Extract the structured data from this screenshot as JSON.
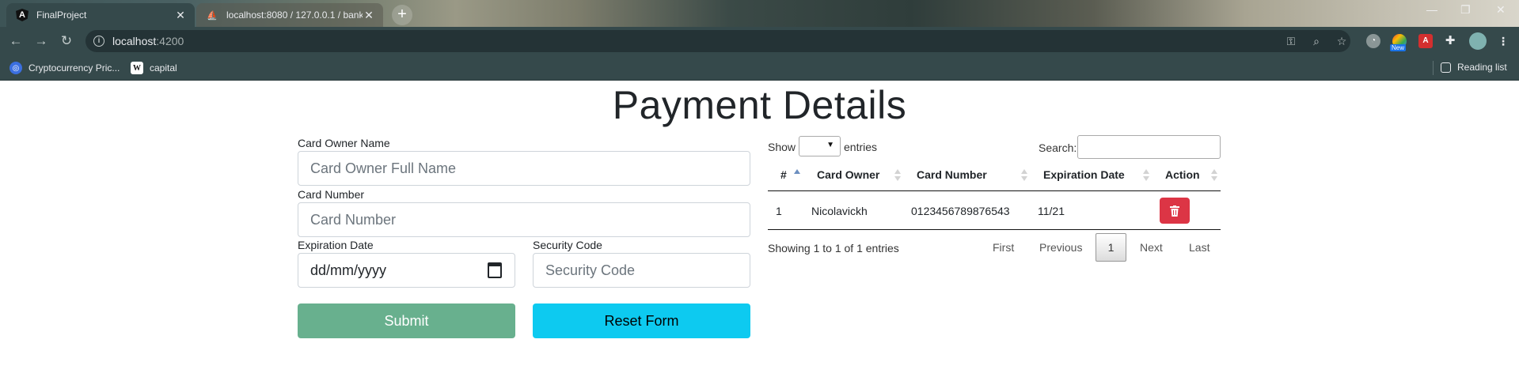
{
  "browser": {
    "tabs": [
      {
        "title": "FinalProject",
        "close": "✕"
      },
      {
        "title": "localhost:8080 / 127.0.0.1 / bank",
        "close": "✕"
      }
    ],
    "new_tab": "+",
    "window_controls": {
      "minimize": "—",
      "restore": "❐",
      "close": "✕"
    },
    "url": {
      "host": "localhost",
      "port": ":4200"
    },
    "extensions": {
      "new_badge": "New",
      "angular_letter": "A"
    },
    "bookmarks": [
      {
        "label": "Cryptocurrency Pric...",
        "icon": "coin-icon"
      },
      {
        "label": "capital",
        "icon": "wikipedia-icon",
        "glyph": "W"
      }
    ],
    "reading_list": "Reading list",
    "colors": {
      "toolbar": "#35494b",
      "omnibox": "#243336"
    }
  },
  "page": {
    "title": "Payment Details",
    "form": {
      "owner_label": "Card Owner Name",
      "owner_placeholder": "Card Owner Full Name",
      "number_label": "Card Number",
      "number_placeholder": "Card Number",
      "expiry_label": "Expiration Date",
      "expiry_value": "dd/mm/yyyy",
      "security_label": "Security Code",
      "security_placeholder": "Security Code",
      "submit_label": "Submit",
      "reset_label": "Reset Form",
      "colors": {
        "submit": "#68b08e",
        "reset": "#0dcaf0"
      }
    },
    "table": {
      "show_label": "Show",
      "entries_label": "entries",
      "search_label": "Search:",
      "columns": [
        "#",
        "Card Owner",
        "Card Number",
        "Expiration Date",
        "Action"
      ],
      "rows": [
        {
          "index": "1",
          "owner": "Nicolavickh",
          "number": "0123456789876543",
          "expiration": "11/21"
        }
      ],
      "info": "Showing 1 to 1 of 1 entries",
      "pagination": {
        "first": "First",
        "previous": "Previous",
        "current": "1",
        "next": "Next",
        "last": "Last"
      },
      "colors": {
        "delete": "#dc3545"
      }
    }
  }
}
